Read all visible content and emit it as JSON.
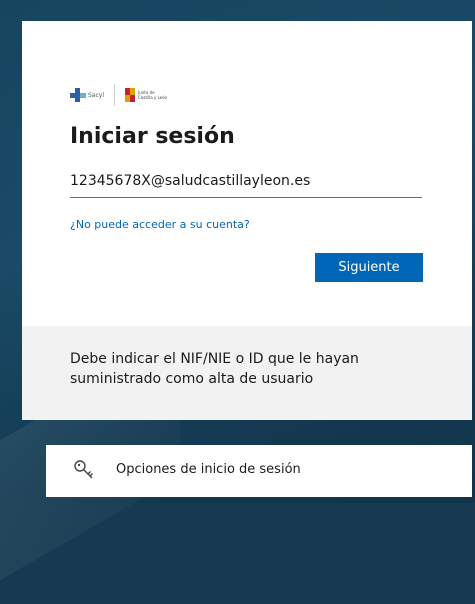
{
  "header": {
    "logo_sacyl": "Sacyl",
    "logo_jcyl_line1": "Junta de",
    "logo_jcyl_line2": "Castilla y León"
  },
  "signin": {
    "title": "Iniciar sesión",
    "email_value": "12345678X@saludcastillayleon.es",
    "cant_access_link": "¿No puede acceder a su cuenta?",
    "next_button": "Siguiente"
  },
  "footer": {
    "message": "Debe indicar el NIF/NIE o ID que le hayan suministrado como alta de usuario"
  },
  "options": {
    "label": "Opciones de inicio de sesión",
    "icon": "key-icon"
  },
  "colors": {
    "accent": "#0067b8",
    "background": "#163a52"
  }
}
